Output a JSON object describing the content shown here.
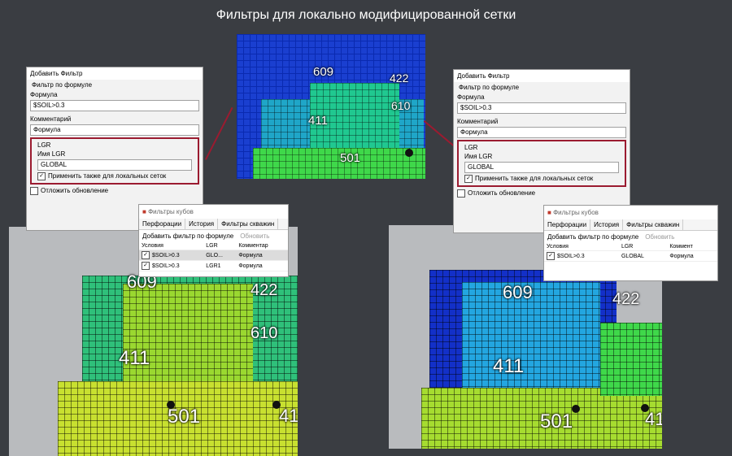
{
  "title": "Фильтры для локально модифицированной сетки",
  "colors": {
    "accent": "#9b1b30",
    "background": "#3a3d42"
  },
  "top_view": {
    "wells": [
      "609",
      "422",
      "610",
      "411",
      "501"
    ]
  },
  "left_view": {
    "wells": [
      "609",
      "422",
      "610",
      "411",
      "501",
      "41"
    ]
  },
  "right_view": {
    "wells": [
      "609",
      "422",
      "411",
      "501",
      "41"
    ]
  },
  "left_dialog": {
    "title": "Добавить Фильтр",
    "group": "Фильтр по формуле",
    "formula_label": "Формула",
    "formula_value": "$SOIL>0.3",
    "comment_label": "Комментарий",
    "comment_value": "Формула",
    "lgr_group": "LGR",
    "lgr_name_label": "Имя LGR",
    "lgr_name_value": "GLOBAL",
    "apply_local_label": "Применить также для локальных сеток",
    "defer_label": "Отложить обновление"
  },
  "right_dialog": {
    "title": "Добавить Фильтр",
    "group": "Фильтр по формуле",
    "formula_label": "Формула",
    "formula_value": "$SOIL>0.3",
    "comment_label": "Комментарий",
    "comment_value": "Формула",
    "lgr_group": "LGR",
    "lgr_name_label": "Имя LGR",
    "lgr_name_value": "GLOBAL",
    "apply_local_label": "Применить также для локальных сеток",
    "defer_label": "Отложить обновление"
  },
  "left_cube": {
    "title": "Фильтры кубов",
    "tabs": [
      "Перфорации",
      "История",
      "Фильтры скважин"
    ],
    "add_label": "Добавить фильтр по формуле",
    "refresh_label": "Обновить",
    "headers": [
      "Условия",
      "LGR",
      "Комментар"
    ],
    "rows": [
      [
        "$SOIL>0.3",
        "GLO...",
        "Формула"
      ],
      [
        "$SOIL>0.3",
        "LGR1",
        "Формула"
      ]
    ]
  },
  "right_cube": {
    "title": "Фильтры кубов",
    "tabs": [
      "Перфорации",
      "История",
      "Фильтры скважин"
    ],
    "add_label": "Добавить фильтр по формуле",
    "refresh_label": "Обновить",
    "headers": [
      "Условия",
      "LGR",
      "Коммент"
    ],
    "rows": [
      [
        "$SOIL>0.3",
        "GLOBAL",
        "Формула"
      ]
    ]
  }
}
